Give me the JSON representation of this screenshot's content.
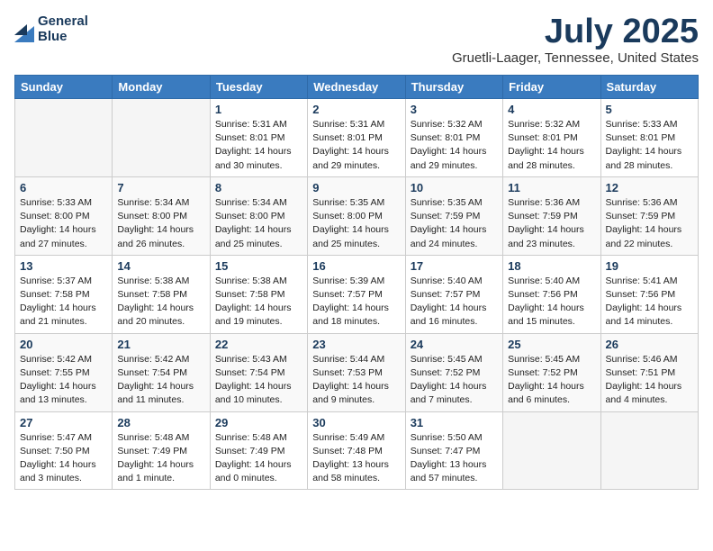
{
  "header": {
    "logo_line1": "General",
    "logo_line2": "Blue",
    "month": "July 2025",
    "location": "Gruetli-Laager, Tennessee, United States"
  },
  "weekdays": [
    "Sunday",
    "Monday",
    "Tuesday",
    "Wednesday",
    "Thursday",
    "Friday",
    "Saturday"
  ],
  "weeks": [
    [
      {
        "day": "",
        "detail": ""
      },
      {
        "day": "",
        "detail": ""
      },
      {
        "day": "1",
        "detail": "Sunrise: 5:31 AM\nSunset: 8:01 PM\nDaylight: 14 hours\nand 30 minutes."
      },
      {
        "day": "2",
        "detail": "Sunrise: 5:31 AM\nSunset: 8:01 PM\nDaylight: 14 hours\nand 29 minutes."
      },
      {
        "day": "3",
        "detail": "Sunrise: 5:32 AM\nSunset: 8:01 PM\nDaylight: 14 hours\nand 29 minutes."
      },
      {
        "day": "4",
        "detail": "Sunrise: 5:32 AM\nSunset: 8:01 PM\nDaylight: 14 hours\nand 28 minutes."
      },
      {
        "day": "5",
        "detail": "Sunrise: 5:33 AM\nSunset: 8:01 PM\nDaylight: 14 hours\nand 28 minutes."
      }
    ],
    [
      {
        "day": "6",
        "detail": "Sunrise: 5:33 AM\nSunset: 8:00 PM\nDaylight: 14 hours\nand 27 minutes."
      },
      {
        "day": "7",
        "detail": "Sunrise: 5:34 AM\nSunset: 8:00 PM\nDaylight: 14 hours\nand 26 minutes."
      },
      {
        "day": "8",
        "detail": "Sunrise: 5:34 AM\nSunset: 8:00 PM\nDaylight: 14 hours\nand 25 minutes."
      },
      {
        "day": "9",
        "detail": "Sunrise: 5:35 AM\nSunset: 8:00 PM\nDaylight: 14 hours\nand 25 minutes."
      },
      {
        "day": "10",
        "detail": "Sunrise: 5:35 AM\nSunset: 7:59 PM\nDaylight: 14 hours\nand 24 minutes."
      },
      {
        "day": "11",
        "detail": "Sunrise: 5:36 AM\nSunset: 7:59 PM\nDaylight: 14 hours\nand 23 minutes."
      },
      {
        "day": "12",
        "detail": "Sunrise: 5:36 AM\nSunset: 7:59 PM\nDaylight: 14 hours\nand 22 minutes."
      }
    ],
    [
      {
        "day": "13",
        "detail": "Sunrise: 5:37 AM\nSunset: 7:58 PM\nDaylight: 14 hours\nand 21 minutes."
      },
      {
        "day": "14",
        "detail": "Sunrise: 5:38 AM\nSunset: 7:58 PM\nDaylight: 14 hours\nand 20 minutes."
      },
      {
        "day": "15",
        "detail": "Sunrise: 5:38 AM\nSunset: 7:58 PM\nDaylight: 14 hours\nand 19 minutes."
      },
      {
        "day": "16",
        "detail": "Sunrise: 5:39 AM\nSunset: 7:57 PM\nDaylight: 14 hours\nand 18 minutes."
      },
      {
        "day": "17",
        "detail": "Sunrise: 5:40 AM\nSunset: 7:57 PM\nDaylight: 14 hours\nand 16 minutes."
      },
      {
        "day": "18",
        "detail": "Sunrise: 5:40 AM\nSunset: 7:56 PM\nDaylight: 14 hours\nand 15 minutes."
      },
      {
        "day": "19",
        "detail": "Sunrise: 5:41 AM\nSunset: 7:56 PM\nDaylight: 14 hours\nand 14 minutes."
      }
    ],
    [
      {
        "day": "20",
        "detail": "Sunrise: 5:42 AM\nSunset: 7:55 PM\nDaylight: 14 hours\nand 13 minutes."
      },
      {
        "day": "21",
        "detail": "Sunrise: 5:42 AM\nSunset: 7:54 PM\nDaylight: 14 hours\nand 11 minutes."
      },
      {
        "day": "22",
        "detail": "Sunrise: 5:43 AM\nSunset: 7:54 PM\nDaylight: 14 hours\nand 10 minutes."
      },
      {
        "day": "23",
        "detail": "Sunrise: 5:44 AM\nSunset: 7:53 PM\nDaylight: 14 hours\nand 9 minutes."
      },
      {
        "day": "24",
        "detail": "Sunrise: 5:45 AM\nSunset: 7:52 PM\nDaylight: 14 hours\nand 7 minutes."
      },
      {
        "day": "25",
        "detail": "Sunrise: 5:45 AM\nSunset: 7:52 PM\nDaylight: 14 hours\nand 6 minutes."
      },
      {
        "day": "26",
        "detail": "Sunrise: 5:46 AM\nSunset: 7:51 PM\nDaylight: 14 hours\nand 4 minutes."
      }
    ],
    [
      {
        "day": "27",
        "detail": "Sunrise: 5:47 AM\nSunset: 7:50 PM\nDaylight: 14 hours\nand 3 minutes."
      },
      {
        "day": "28",
        "detail": "Sunrise: 5:48 AM\nSunset: 7:49 PM\nDaylight: 14 hours\nand 1 minute."
      },
      {
        "day": "29",
        "detail": "Sunrise: 5:48 AM\nSunset: 7:49 PM\nDaylight: 14 hours\nand 0 minutes."
      },
      {
        "day": "30",
        "detail": "Sunrise: 5:49 AM\nSunset: 7:48 PM\nDaylight: 13 hours\nand 58 minutes."
      },
      {
        "day": "31",
        "detail": "Sunrise: 5:50 AM\nSunset: 7:47 PM\nDaylight: 13 hours\nand 57 minutes."
      },
      {
        "day": "",
        "detail": ""
      },
      {
        "day": "",
        "detail": ""
      }
    ]
  ]
}
